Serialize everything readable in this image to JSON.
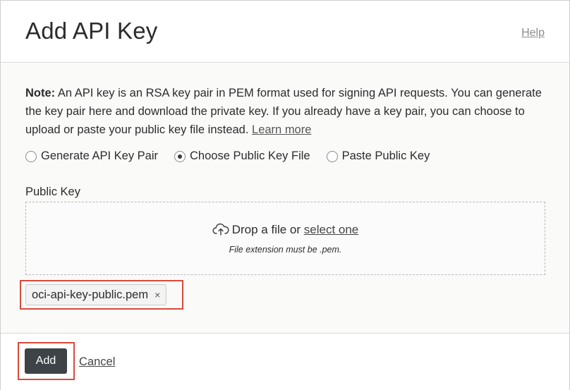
{
  "header": {
    "title": "Add API Key",
    "help_label": "Help"
  },
  "note": {
    "label": "Note:",
    "text": " An API key is an RSA key pair in PEM format used for signing API requests. You can generate the key pair here and download the private key. If you already have a key pair, you can choose to upload or paste your public key file instead. ",
    "learn_more": "Learn more"
  },
  "options": {
    "items": [
      {
        "label": "Generate API Key Pair",
        "selected": false
      },
      {
        "label": "Choose Public Key File",
        "selected": true
      },
      {
        "label": "Paste Public Key",
        "selected": false
      }
    ]
  },
  "public_key": {
    "label": "Public Key",
    "drop_text": "Drop a file or ",
    "select_link": "select one",
    "hint": "File extension must be .pem.",
    "file_name": "oci-api-key-public.pem",
    "remove_icon": "×"
  },
  "footer": {
    "add_label": "Add",
    "cancel_label": "Cancel"
  },
  "colors": {
    "highlight": "#d94a3b",
    "primary_button": "#3e4347"
  }
}
